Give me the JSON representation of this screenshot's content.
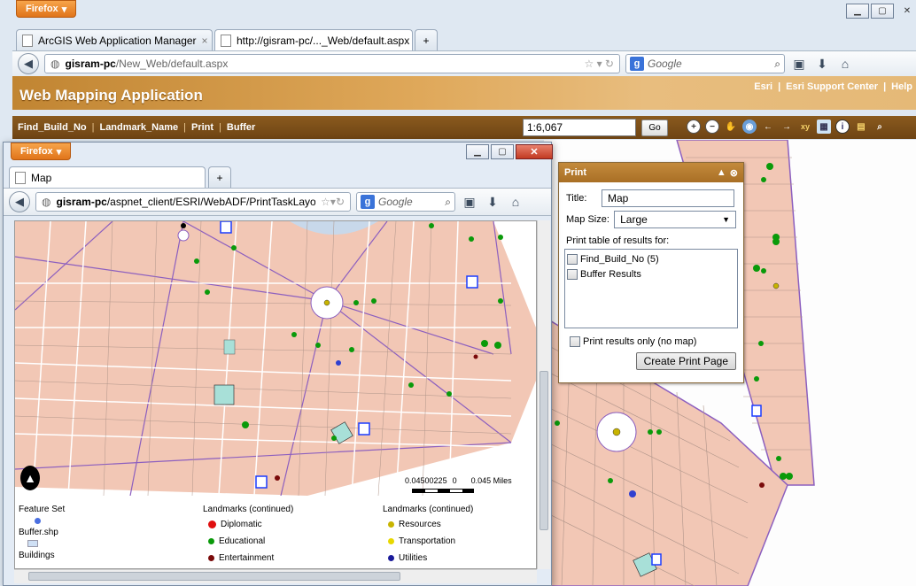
{
  "bg_browser": {
    "menu_button": "Firefox",
    "tabs": [
      {
        "label": "ArcGIS Web Application Manager"
      },
      {
        "label": "http://gisram-pc/..._Web/default.aspx"
      }
    ],
    "url_host": "gisram-pc",
    "url_path": "/New_Web/default.aspx",
    "search_placeholder": "Google"
  },
  "app": {
    "title": "Web Mapping Application",
    "links": [
      "Esri",
      "Esri Support Center",
      "Help"
    ],
    "toolbar_items": [
      "Find_Build_No",
      "Landmark_Name",
      "Print",
      "Buffer"
    ],
    "scale": "1:6,067",
    "go_label": "Go"
  },
  "print_panel": {
    "title": "Print",
    "title_label": "Title:",
    "title_value": "Map",
    "map_size_label": "Map Size:",
    "map_size_value": "Large",
    "table_label": "Print table of results for:",
    "table_items": [
      "Find_Build_No (5)",
      "Buffer Results"
    ],
    "results_only_label": "Print results only (no map)",
    "create_button": "Create Print Page"
  },
  "fg_browser": {
    "menu_button": "Firefox",
    "tab_label": "Map",
    "url_host": "gisram-pc",
    "url_path": "/aspnet_client/ESRI/WebADF/PrintTaskLayout",
    "search_placeholder": "Google",
    "scalebar_left": "0.04",
    "scalebar_mid": "50",
    "scalebar_mid2": "0225",
    "scalebar_zero": "0",
    "scalebar_right": "0.045 Miles",
    "legend": {
      "col1_title": "Feature Set",
      "col1_items": [
        "Buffer.shp",
        "Buildings"
      ],
      "col2_title": "Landmarks (continued)",
      "col2_items": [
        "Diplomatic",
        "Educational",
        "Entertainment"
      ],
      "col3_title": "Landmarks (continued)",
      "col3_items": [
        "Resources",
        "Transportation",
        "Utilities"
      ]
    }
  },
  "colors": {
    "parcel": "#f2c7b5",
    "road_line": "#8c5fbf",
    "header_brown": "#c18532",
    "toolbar_brown": "#7a4d18"
  }
}
